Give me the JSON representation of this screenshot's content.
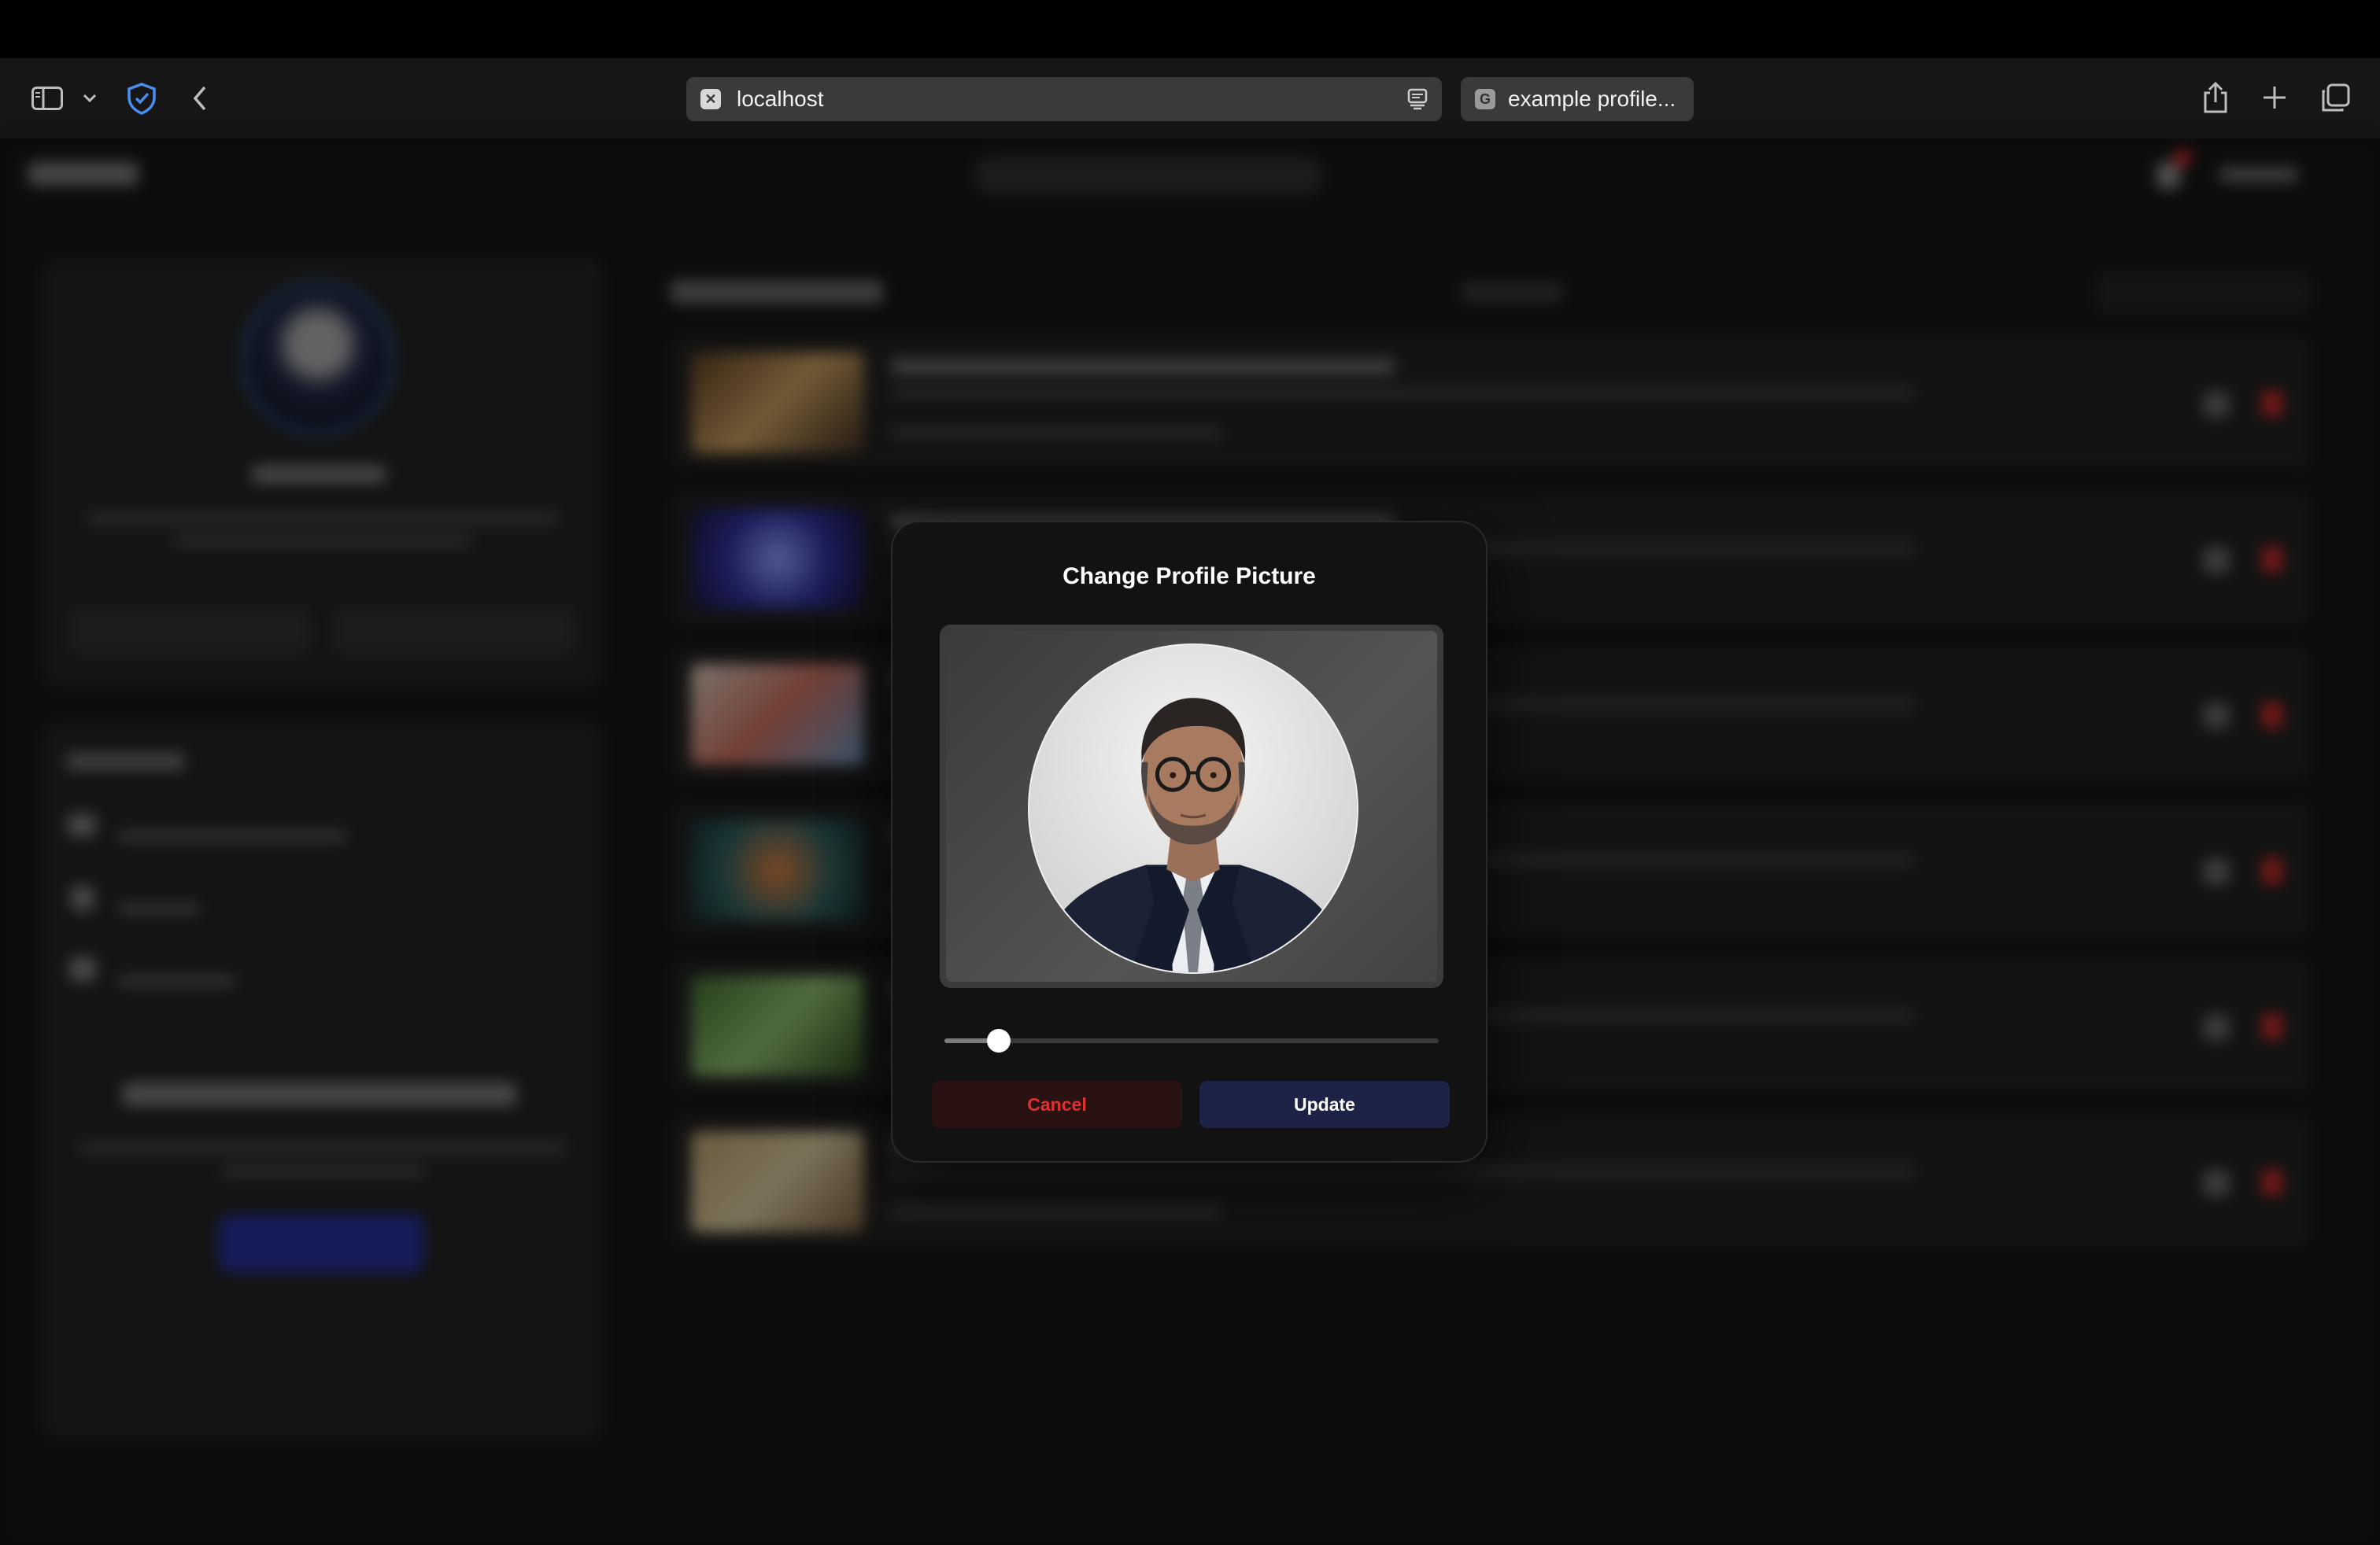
{
  "browser": {
    "url": "localhost",
    "url_favicon": "x-icon",
    "tab2_title": "example profile...",
    "tab2_favicon": "G"
  },
  "modal": {
    "title": "Change Profile Picture",
    "zoom_level": 0.11,
    "cancel_label": "Cancel",
    "update_label": "Update"
  },
  "colors": {
    "cancel_text": "#e03030",
    "cancel_bg": "#2a1212",
    "update_bg": "#1c2347",
    "modal_bg": "#121212"
  }
}
